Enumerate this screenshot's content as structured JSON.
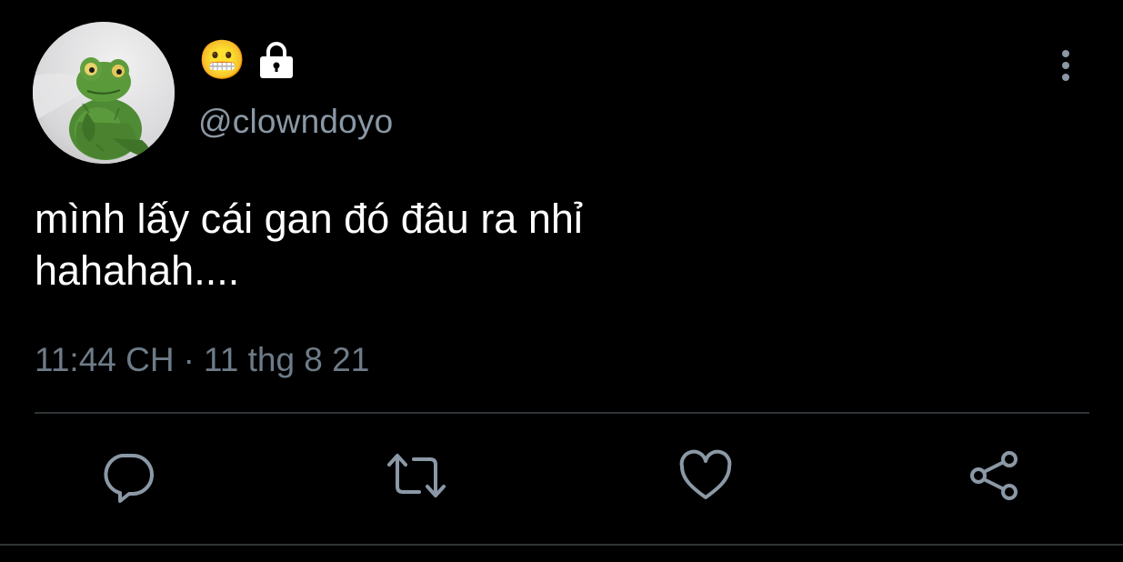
{
  "tweet": {
    "author": {
      "display_name_emoji": "😬",
      "protected_icon": "lock-icon",
      "handle": "@clowndoyo",
      "avatar_icon": "green-plush-frog-avatar"
    },
    "text": "mình lấy cái gan đó đâu ra nhỉ\nhahahah....",
    "time": "11:44 CH",
    "separator": "·",
    "date": "11 thg 8 21"
  },
  "actions": {
    "reply_icon": "reply-icon",
    "retweet_icon": "retweet-icon",
    "like_icon": "heart-icon",
    "share_icon": "share-icon",
    "more_icon": "more-vertical-icon"
  },
  "colors": {
    "background": "#000000",
    "primary_text": "#ffffff",
    "secondary_text": "#8b98a5",
    "icon": "#8b98a5",
    "divider": "#2f3336"
  }
}
